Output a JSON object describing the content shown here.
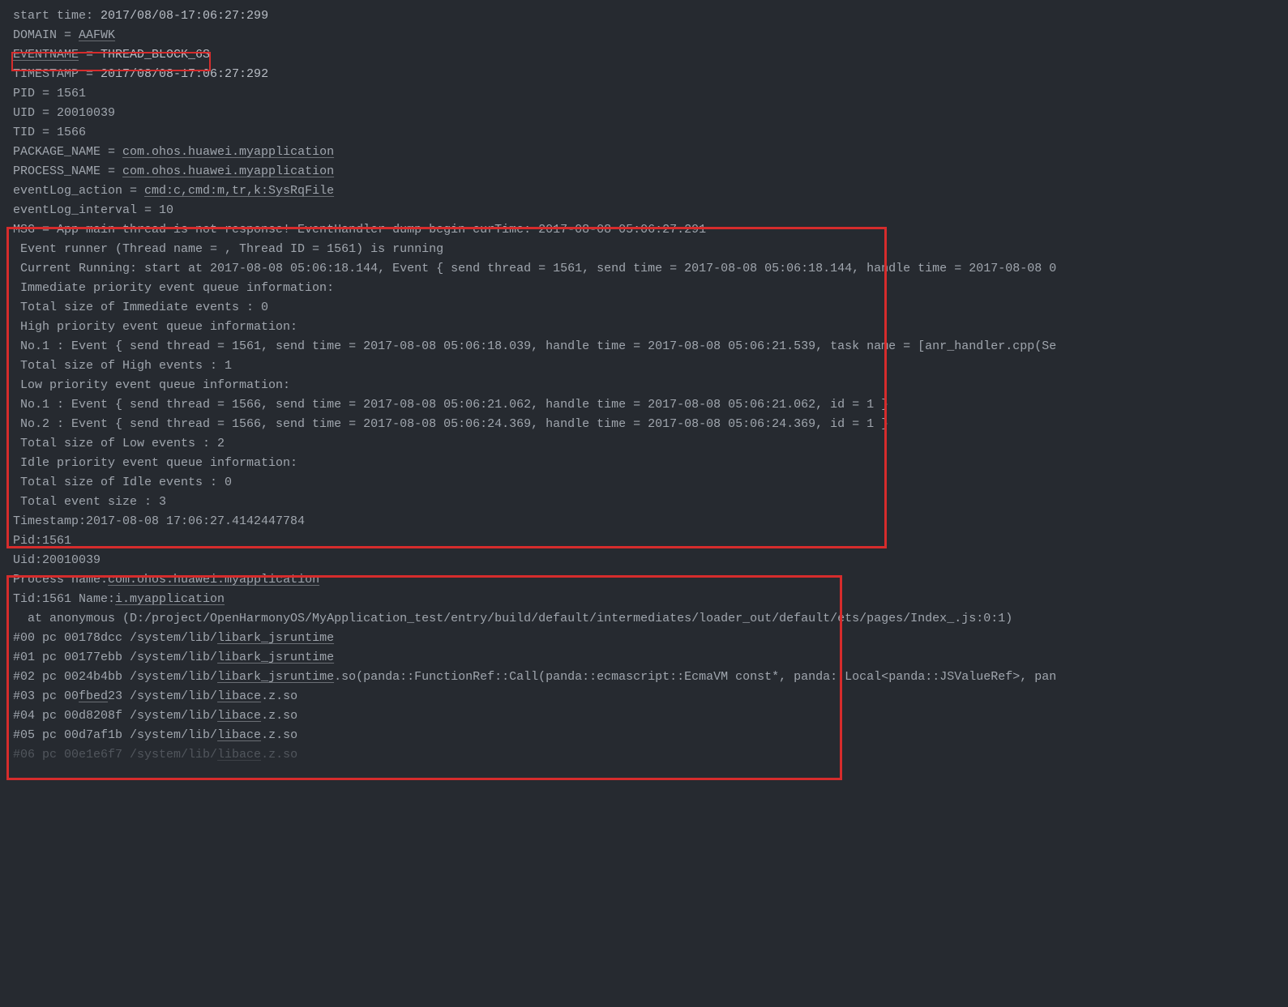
{
  "lines": {
    "l01a": "start time: ",
    "l01b": "2017/08/08-17:06:27:299",
    "l02a": "DOMAIN = ",
    "l02b": "AAFWK",
    "l03a": "EVENTNAME",
    "l03b": " = ",
    "l03c": "THREAD_BLOCK_6S",
    "l04a": "TIMESTAMP = ",
    "l04b": "2017/08/08-17:06:27:292",
    "l05": "PID = 1561",
    "l06": "UID = 20010039",
    "l07": "TID = 1566",
    "l08a": "PACKAGE_NAME = ",
    "l08b": "com.ohos.huawei.myapplication",
    "l09a": "PROCESS_NAME = ",
    "l09b": "com.ohos.huawei.myapplication",
    "l10a": "eventLog_action = ",
    "l10b": "cmd:c,cmd:m,tr,k:SysRqFile",
    "l11": "eventLog_interval = 10",
    "l12": "MSG = App main thread is not response! EventHandler dump begin curTime: 2017-08-08 05:06:27.291",
    "l13": " Event runner (Thread name = , Thread ID = 1561) is running",
    "l14": " Current Running: start at 2017-08-08 05:06:18.144, Event { send thread = 1561, send time = 2017-08-08 05:06:18.144, handle time = 2017-08-08 0",
    "l15": " Immediate priority event queue information:",
    "l16": " Total size of Immediate events : 0",
    "l17": " High priority event queue information:",
    "l18": " No.1 : Event { send thread = 1561, send time = 2017-08-08 05:06:18.039, handle time = 2017-08-08 05:06:21.539, task name = [anr_handler.cpp(Se",
    "l19": " Total size of High events : 1",
    "l20": " Low priority event queue information:",
    "l21": " No.1 : Event { send thread = 1566, send time = 2017-08-08 05:06:21.062, handle time = 2017-08-08 05:06:21.062, id = 1 }",
    "l22": " No.2 : Event { send thread = 1566, send time = 2017-08-08 05:06:24.369, handle time = 2017-08-08 05:06:24.369, id = 1 }",
    "l23": " Total size of Low events : 2",
    "l24": " Idle priority event queue information:",
    "l25": " Total size of Idle events : 0",
    "l26": " Total event size : 3",
    "l27": "",
    "l28": "Timestamp:2017-08-08 17:06:27.4142447784",
    "l29": "Pid:1561",
    "l30": "Uid:20010039",
    "l31a": "Process name:",
    "l31b": "com.ohos.huawei.myapplication",
    "l32a": "Tid:1561 Name:",
    "l32b": "i.myapplication",
    "l33": "  at anonymous (D:/project/OpenHarmonyOS/MyApplication_test/entry/build/default/intermediates/loader_out/default/ets/pages/Index_.js:0:1)",
    "l34a": "#00 pc 00178dcc /system/lib/",
    "l34b": "libark_jsruntime",
    ".so": ".so",
    "l35a": "#01 pc 00177ebb /system/lib/",
    "l35b": "libark_jsruntime",
    "l36a": "#02 pc 0024b4bb /system/lib/",
    "l36b": "libark_jsruntime",
    "l36c": ".so(panda::FunctionRef::Call(panda::ecmascript::EcmaVM const*, panda::Local<panda::JSValueRef>, pan",
    "l37a": "#03 pc 00",
    "l37b": "fbed",
    "l37c": "23 /system/lib/",
    "l37d": "libace",
    "l37e": ".z.so",
    "l38a": "#04 pc 00d8208f /system/lib/",
    "l38b": "libace",
    "l38c": ".z.so",
    "l39a": "#05 pc 00d7af1b /system/lib/",
    "l39b": "libace",
    "l39c": ".z.so",
    "l40a": "#06 pc 00e1e6f7 /system/lib/",
    "l40b": "libace",
    "l40c": ".z.so"
  }
}
